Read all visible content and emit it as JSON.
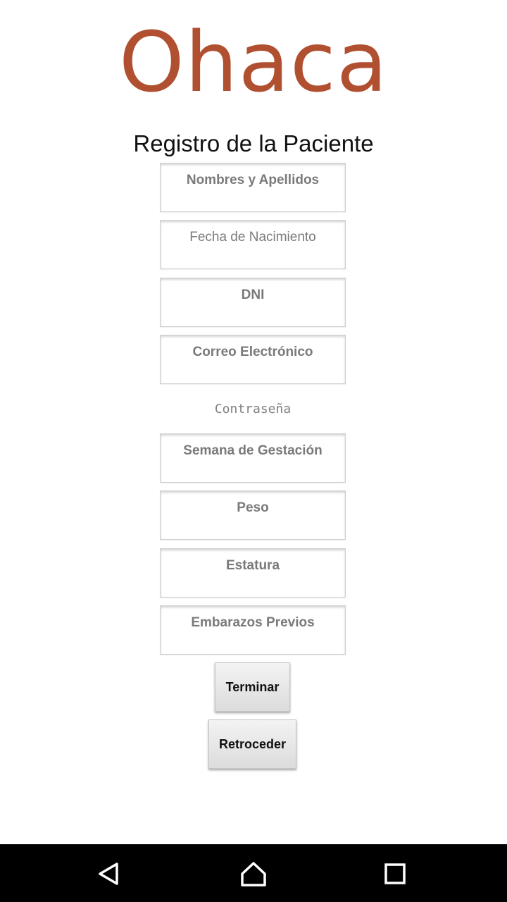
{
  "app": {
    "logo_text": "Ohaca",
    "brand_color": "#b05030"
  },
  "form": {
    "title": "Registro de la Paciente",
    "fields": {
      "nombres": "Nombres y Apellidos",
      "fecha": "Fecha de Nacimiento",
      "dni": "DNI",
      "correo": "Correo Electrónico",
      "contrasena": "Contraseña",
      "semana": "Semana de Gestación",
      "peso": "Peso",
      "estatura": "Estatura",
      "embarazos": "Embarazos Previos"
    },
    "buttons": {
      "terminar": "Terminar",
      "retroceder": "Retroceder"
    }
  },
  "navbar": {
    "icons": [
      "back-icon",
      "home-icon",
      "recents-icon"
    ]
  }
}
